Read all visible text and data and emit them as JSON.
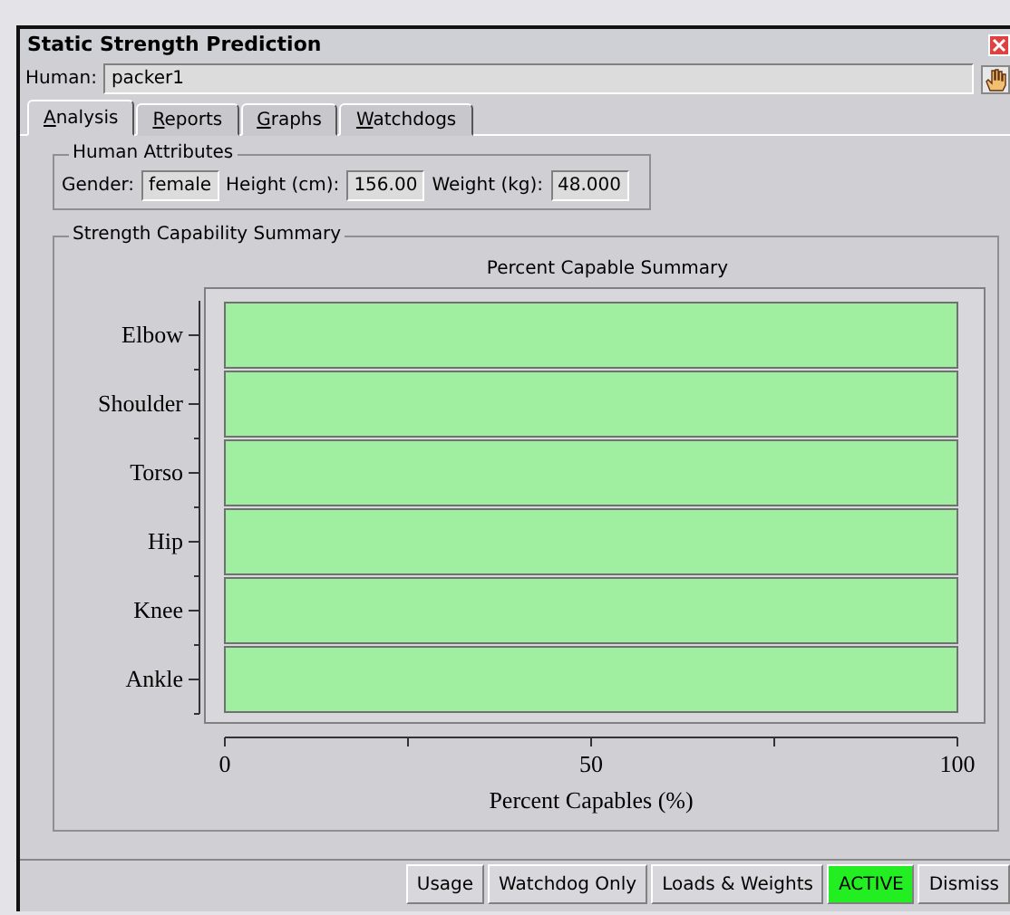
{
  "window": {
    "title": "Static Strength Prediction"
  },
  "human": {
    "label": "Human:",
    "value": "packer1"
  },
  "tabs": [
    {
      "label": "Analysis",
      "selected": true
    },
    {
      "label": "Reports",
      "selected": false
    },
    {
      "label": "Graphs",
      "selected": false
    },
    {
      "label": "Watchdogs",
      "selected": false
    }
  ],
  "human_attributes": {
    "title": "Human Attributes",
    "fields": [
      {
        "label": "Gender:",
        "value": "female"
      },
      {
        "label": "Height (cm):",
        "value": "156.00"
      },
      {
        "label": "Weight (kg):",
        "value": "48.000"
      }
    ]
  },
  "strength_summary": {
    "title": "Strength Capability Summary",
    "chart_data": {
      "type": "bar",
      "orientation": "horizontal",
      "title": "Percent Capable Summary",
      "xlabel": "Percent Capables (%)",
      "categories": [
        "Elbow",
        "Shoulder",
        "Torso",
        "Hip",
        "Knee",
        "Ankle"
      ],
      "series": [
        {
          "color": "#a0eea0",
          "values": [
            100,
            100,
            100,
            100,
            100,
            100
          ]
        }
      ],
      "xlim": [
        0,
        100
      ],
      "xticks": [
        0,
        50,
        100
      ]
    }
  },
  "status_bar": [
    {
      "label": "Usage",
      "active": false
    },
    {
      "label": "Watchdog Only",
      "active": false
    },
    {
      "label": "Loads & Weights",
      "active": false
    },
    {
      "label": "ACTIVE",
      "active": true
    },
    {
      "label": "Dismiss",
      "active": false
    }
  ]
}
